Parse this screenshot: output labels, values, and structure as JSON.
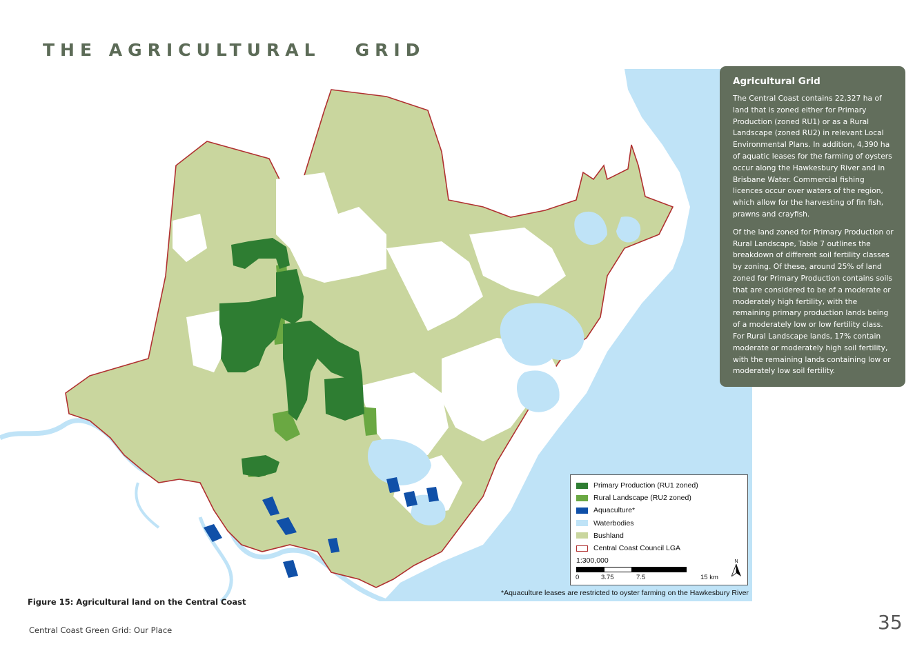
{
  "page": {
    "title": "THE AGRICULTURAL   GRID",
    "figure_caption": "Figure 15: Agricultural land on the Central Coast",
    "footer_left": "Central Coast Green Grid: Our Place",
    "page_number": "35"
  },
  "info_panel": {
    "title": "Agricultural Grid",
    "paragraphs": [
      "The Central Coast contains 22,327 ha of land that is zoned either for Primary Production (zoned RU1) or as a Rural Landscape (zoned RU2) in relevant Local Environmental Plans. In addition, 4,390 ha of aquatic leases for the farming of oysters occur along the Hawkesbury River and in Brisbane Water. Commercial fishing licences occur over waters of the region, which allow for the harvesting of fin fish, prawns and crayfish.",
      "Of the land zoned for Primary Production or Rural Landscape, Table 7 outlines the breakdown of different soil fertility classes by zoning. Of these, around 25% of land zoned for Primary Production contains soils that are considered to be of a moderate or moderately high fertility, with the remaining primary production lands being of a moderately low or low fertility class. For Rural Landscape lands, 17% contain moderate or moderately high soil fertility, with the remaining lands containing low or moderately low soil fertility."
    ],
    "background_color": "#626e5c"
  },
  "legend": {
    "items": [
      {
        "label": "Primary Production (RU1 zoned)",
        "color": "#2e7d32",
        "icon": "filled-swatch"
      },
      {
        "label": "Rural Landscape (RU2 zoned)",
        "color": "#6aa842",
        "icon": "filled-swatch"
      },
      {
        "label": "Aquaculture*",
        "color": "#1050a8",
        "icon": "filled-swatch"
      },
      {
        "label": "Waterbodies",
        "color": "#bfe3f7",
        "icon": "filled-swatch"
      },
      {
        "label": "Bushland",
        "color": "#c9d69e",
        "icon": "filled-swatch"
      },
      {
        "label": "Central Coast Council LGA",
        "color": "#b03030",
        "icon": "outline-swatch"
      }
    ],
    "scale_label": "1:300,000",
    "scale_ticks": [
      "0",
      "3.75",
      "7.5",
      "15 km"
    ],
    "north_label": "N",
    "north_icon": "north-arrow-icon"
  },
  "map": {
    "footnote": "*Aquaculture leases are restricted to oyster farming on the Hawkesbury River",
    "colors": {
      "ocean": "#bfe3f7",
      "land": "#ffffff",
      "bushland": "#c9d69e",
      "primary": "#2e7d32",
      "rural": "#6aa842",
      "aquaculture": "#1050a8",
      "boundary": "#b03030"
    }
  }
}
